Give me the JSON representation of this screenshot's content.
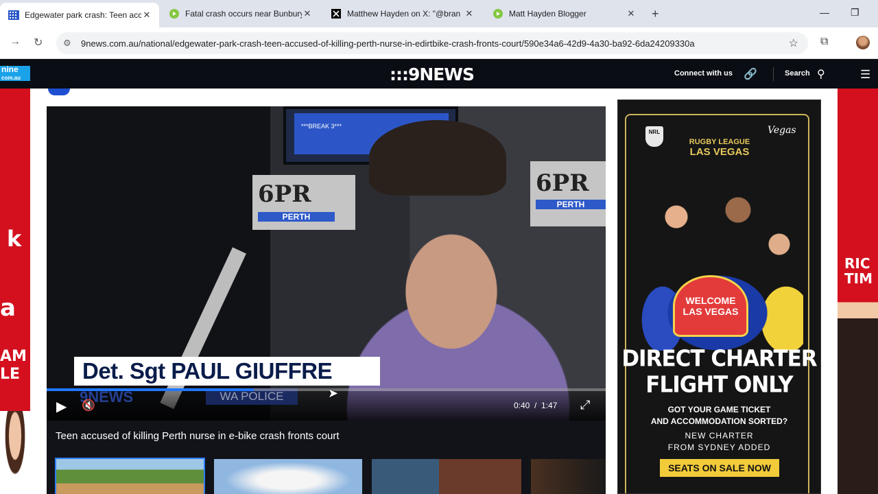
{
  "browser": {
    "tabs": [
      {
        "title": "Edgewater park crash: Teen acc",
        "active": true,
        "favicon": "nine-news-icon"
      },
      {
        "title": "Fatal crash occurs near Bunbury",
        "active": false,
        "favicon": "rumble-play-icon"
      },
      {
        "title": "Matthew Hayden on X: \"@bran",
        "active": false,
        "favicon": "x-logo-icon"
      },
      {
        "title": "Matt Hayden Blogger",
        "active": false,
        "favicon": "rumble-play-icon"
      }
    ],
    "new_tab": "+",
    "url": "9news.com.au/national/edgewater-park-crash-teen-accused-of-killing-perth-nurse-in-edirtbike-crash-fronts-court/590e34a6-42d9-4a30-ba92-6da24209330a"
  },
  "site": {
    "nine_logo_line1": "nine",
    "nine_logo_line2": "com.au",
    "news_logo": ":::9NEWS",
    "connect_label": "Connect with us",
    "search_label": "Search"
  },
  "side_ads": {
    "left_texts": [
      "k",
      "a",
      "AM",
      "LE"
    ],
    "right_text_line1": "RIC",
    "right_text_line2": "TIM"
  },
  "video": {
    "studio_screen_text": "***BREAK 3***",
    "studio_brand": "6PR",
    "studio_brand_sub": "PERTH",
    "lower_third": "Det. Sgt PAUL GIUFFRE",
    "watermark": "9NEWS",
    "watermark_tag": "WA POLICE",
    "current_time": "0:40",
    "time_separator": "/",
    "duration": "1:47",
    "progress_fraction": 0.37,
    "caption": "Teen accused of killing Perth nurse in e-bike crash fronts court"
  },
  "ad": {
    "nrl": "NRL",
    "vegas_small": "Vegas",
    "league_line": "RUGBY LEAGUE",
    "league_city": "LAS VEGAS",
    "welcome": "WELCOME LAS VEGAS",
    "headline_line1": "DIRECT CHARTER",
    "headline_line2": "FLIGHT ONLY",
    "sub_line1": "GOT YOUR GAME TICKET",
    "sub_line2": "AND ACCOMMODATION SORTED?",
    "note_line1": "NEW CHARTER",
    "note_line2": "FROM SYDNEY ADDED",
    "cta": "SEATS ON SALE NOW"
  },
  "colors": {
    "page_red": "#d4101f",
    "header_bg": "#0a0d14",
    "progress_blue": "#1f77ff",
    "ad_gold": "#e7c95c",
    "cta_yellow": "#f1cb3a"
  }
}
